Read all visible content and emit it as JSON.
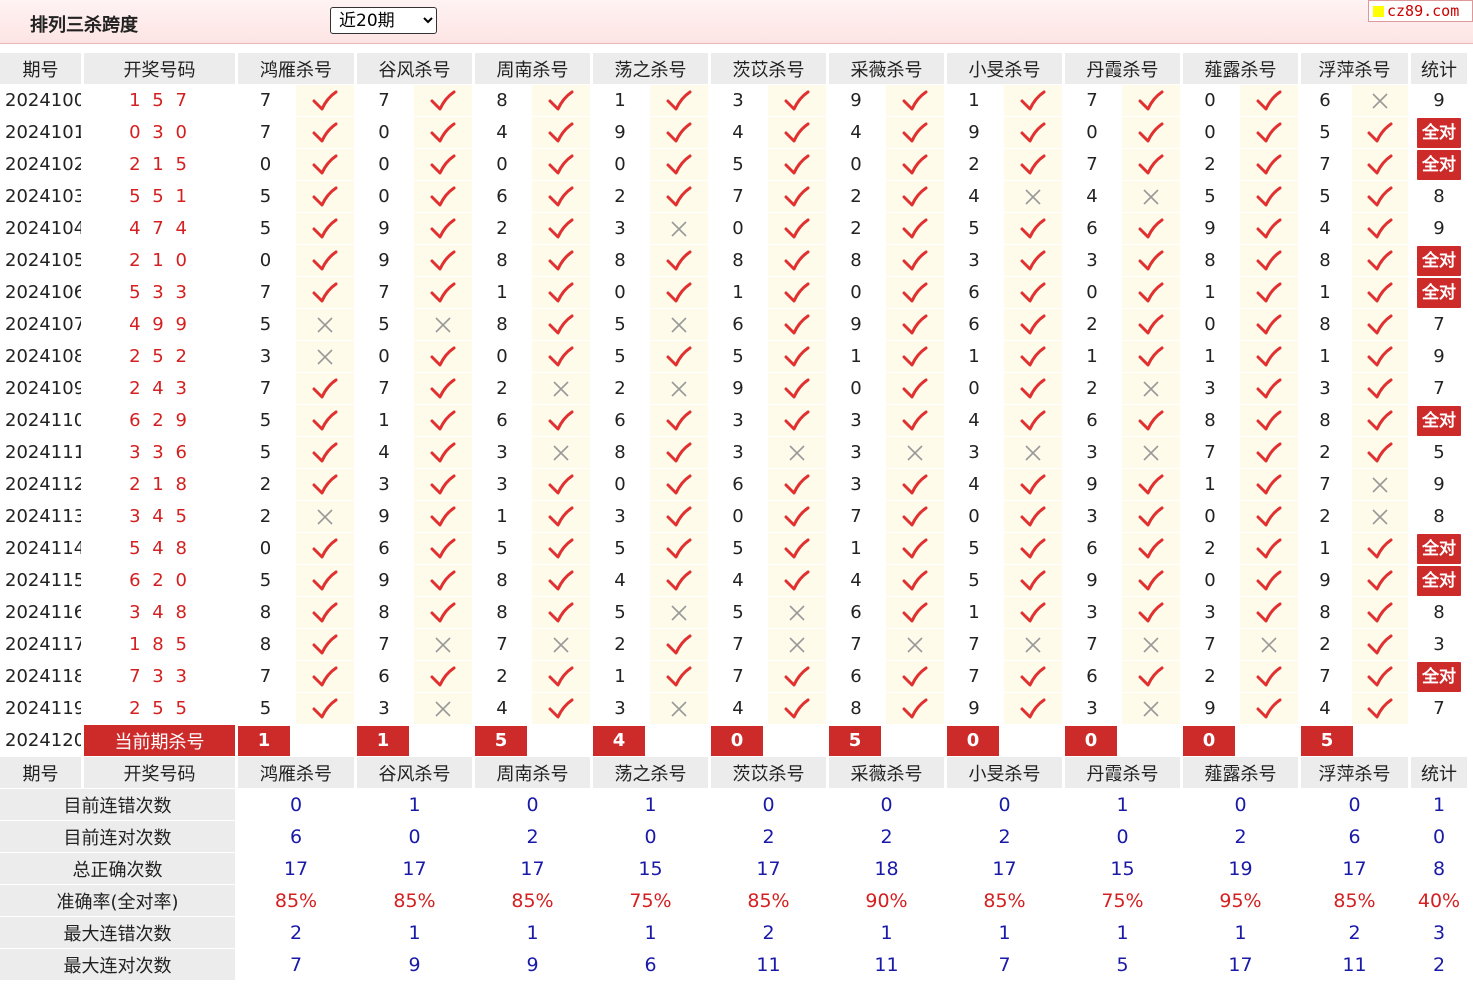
{
  "header": {
    "title": "排列三杀跨度",
    "period_select": {
      "selected": "近20期",
      "options": [
        "近20期"
      ]
    },
    "logo": "cz89.com"
  },
  "columns": [
    "期号",
    "开奖号码",
    "鸿雁杀号",
    "谷风杀号",
    "周南杀号",
    "荡之杀号",
    "茨苡杀号",
    "采薇杀号",
    "小旻杀号",
    "丹霞杀号",
    "薤露杀号",
    "浮萍杀号",
    "统计"
  ],
  "rows": [
    {
      "period": "2024100",
      "draw": "157",
      "kills": [
        [
          7,
          1
        ],
        [
          7,
          1
        ],
        [
          8,
          1
        ],
        [
          1,
          1
        ],
        [
          3,
          1
        ],
        [
          9,
          1
        ],
        [
          1,
          1
        ],
        [
          7,
          1
        ],
        [
          0,
          1
        ],
        [
          6,
          0
        ]
      ],
      "stat": "9"
    },
    {
      "period": "2024101",
      "draw": "030",
      "kills": [
        [
          7,
          1
        ],
        [
          0,
          1
        ],
        [
          4,
          1
        ],
        [
          9,
          1
        ],
        [
          4,
          1
        ],
        [
          4,
          1
        ],
        [
          9,
          1
        ],
        [
          0,
          1
        ],
        [
          0,
          1
        ],
        [
          5,
          1
        ]
      ],
      "stat": "全对"
    },
    {
      "period": "2024102",
      "draw": "215",
      "kills": [
        [
          0,
          1
        ],
        [
          0,
          1
        ],
        [
          0,
          1
        ],
        [
          0,
          1
        ],
        [
          5,
          1
        ],
        [
          0,
          1
        ],
        [
          2,
          1
        ],
        [
          7,
          1
        ],
        [
          2,
          1
        ],
        [
          7,
          1
        ]
      ],
      "stat": "全对"
    },
    {
      "period": "2024103",
      "draw": "551",
      "kills": [
        [
          5,
          1
        ],
        [
          0,
          1
        ],
        [
          6,
          1
        ],
        [
          2,
          1
        ],
        [
          7,
          1
        ],
        [
          2,
          1
        ],
        [
          4,
          0
        ],
        [
          4,
          0
        ],
        [
          5,
          1
        ],
        [
          5,
          1
        ]
      ],
      "stat": "8"
    },
    {
      "period": "2024104",
      "draw": "474",
      "kills": [
        [
          5,
          1
        ],
        [
          9,
          1
        ],
        [
          2,
          1
        ],
        [
          3,
          0
        ],
        [
          0,
          1
        ],
        [
          2,
          1
        ],
        [
          5,
          1
        ],
        [
          6,
          1
        ],
        [
          9,
          1
        ],
        [
          4,
          1
        ]
      ],
      "stat": "9"
    },
    {
      "period": "2024105",
      "draw": "210",
      "kills": [
        [
          0,
          1
        ],
        [
          9,
          1
        ],
        [
          8,
          1
        ],
        [
          8,
          1
        ],
        [
          8,
          1
        ],
        [
          8,
          1
        ],
        [
          3,
          1
        ],
        [
          3,
          1
        ],
        [
          8,
          1
        ],
        [
          8,
          1
        ]
      ],
      "stat": "全对"
    },
    {
      "period": "2024106",
      "draw": "533",
      "kills": [
        [
          7,
          1
        ],
        [
          7,
          1
        ],
        [
          1,
          1
        ],
        [
          0,
          1
        ],
        [
          1,
          1
        ],
        [
          0,
          1
        ],
        [
          6,
          1
        ],
        [
          0,
          1
        ],
        [
          1,
          1
        ],
        [
          1,
          1
        ]
      ],
      "stat": "全对"
    },
    {
      "period": "2024107",
      "draw": "499",
      "kills": [
        [
          5,
          0
        ],
        [
          5,
          0
        ],
        [
          8,
          1
        ],
        [
          5,
          0
        ],
        [
          6,
          1
        ],
        [
          9,
          1
        ],
        [
          6,
          1
        ],
        [
          2,
          1
        ],
        [
          0,
          1
        ],
        [
          8,
          1
        ]
      ],
      "stat": "7"
    },
    {
      "period": "2024108",
      "draw": "252",
      "kills": [
        [
          3,
          0
        ],
        [
          0,
          1
        ],
        [
          0,
          1
        ],
        [
          5,
          1
        ],
        [
          5,
          1
        ],
        [
          1,
          1
        ],
        [
          1,
          1
        ],
        [
          1,
          1
        ],
        [
          1,
          1
        ],
        [
          1,
          1
        ]
      ],
      "stat": "9"
    },
    {
      "period": "2024109",
      "draw": "243",
      "kills": [
        [
          7,
          1
        ],
        [
          7,
          1
        ],
        [
          2,
          0
        ],
        [
          2,
          0
        ],
        [
          9,
          1
        ],
        [
          0,
          1
        ],
        [
          0,
          1
        ],
        [
          2,
          0
        ],
        [
          3,
          1
        ],
        [
          3,
          1
        ]
      ],
      "stat": "7"
    },
    {
      "period": "2024110",
      "draw": "629",
      "kills": [
        [
          5,
          1
        ],
        [
          1,
          1
        ],
        [
          6,
          1
        ],
        [
          6,
          1
        ],
        [
          3,
          1
        ],
        [
          3,
          1
        ],
        [
          4,
          1
        ],
        [
          6,
          1
        ],
        [
          8,
          1
        ],
        [
          8,
          1
        ]
      ],
      "stat": "全对"
    },
    {
      "period": "2024111",
      "draw": "336",
      "kills": [
        [
          5,
          1
        ],
        [
          4,
          1
        ],
        [
          3,
          0
        ],
        [
          8,
          1
        ],
        [
          3,
          0
        ],
        [
          3,
          0
        ],
        [
          3,
          0
        ],
        [
          3,
          0
        ],
        [
          7,
          1
        ],
        [
          2,
          1
        ]
      ],
      "stat": "5"
    },
    {
      "period": "2024112",
      "draw": "218",
      "kills": [
        [
          2,
          1
        ],
        [
          3,
          1
        ],
        [
          3,
          1
        ],
        [
          0,
          1
        ],
        [
          6,
          1
        ],
        [
          3,
          1
        ],
        [
          4,
          1
        ],
        [
          9,
          1
        ],
        [
          1,
          1
        ],
        [
          7,
          0
        ]
      ],
      "stat": "9"
    },
    {
      "period": "2024113",
      "draw": "345",
      "kills": [
        [
          2,
          0
        ],
        [
          9,
          1
        ],
        [
          1,
          1
        ],
        [
          3,
          1
        ],
        [
          0,
          1
        ],
        [
          7,
          1
        ],
        [
          0,
          1
        ],
        [
          3,
          1
        ],
        [
          0,
          1
        ],
        [
          2,
          0
        ]
      ],
      "stat": "8"
    },
    {
      "period": "2024114",
      "draw": "548",
      "kills": [
        [
          0,
          1
        ],
        [
          6,
          1
        ],
        [
          5,
          1
        ],
        [
          5,
          1
        ],
        [
          5,
          1
        ],
        [
          1,
          1
        ],
        [
          5,
          1
        ],
        [
          6,
          1
        ],
        [
          2,
          1
        ],
        [
          1,
          1
        ]
      ],
      "stat": "全对"
    },
    {
      "period": "2024115",
      "draw": "620",
      "kills": [
        [
          5,
          1
        ],
        [
          9,
          1
        ],
        [
          8,
          1
        ],
        [
          4,
          1
        ],
        [
          4,
          1
        ],
        [
          4,
          1
        ],
        [
          5,
          1
        ],
        [
          9,
          1
        ],
        [
          0,
          1
        ],
        [
          9,
          1
        ]
      ],
      "stat": "全对"
    },
    {
      "period": "2024116",
      "draw": "348",
      "kills": [
        [
          8,
          1
        ],
        [
          8,
          1
        ],
        [
          8,
          1
        ],
        [
          5,
          0
        ],
        [
          5,
          0
        ],
        [
          6,
          1
        ],
        [
          1,
          1
        ],
        [
          3,
          1
        ],
        [
          3,
          1
        ],
        [
          8,
          1
        ]
      ],
      "stat": "8"
    },
    {
      "period": "2024117",
      "draw": "185",
      "kills": [
        [
          8,
          1
        ],
        [
          7,
          0
        ],
        [
          7,
          0
        ],
        [
          2,
          1
        ],
        [
          7,
          0
        ],
        [
          7,
          0
        ],
        [
          7,
          0
        ],
        [
          7,
          0
        ],
        [
          7,
          0
        ],
        [
          2,
          1
        ]
      ],
      "stat": "3"
    },
    {
      "period": "2024118",
      "draw": "733",
      "kills": [
        [
          7,
          1
        ],
        [
          6,
          1
        ],
        [
          2,
          1
        ],
        [
          1,
          1
        ],
        [
          7,
          1
        ],
        [
          6,
          1
        ],
        [
          7,
          1
        ],
        [
          6,
          1
        ],
        [
          2,
          1
        ],
        [
          7,
          1
        ]
      ],
      "stat": "全对"
    },
    {
      "period": "2024119",
      "draw": "255",
      "kills": [
        [
          5,
          1
        ],
        [
          3,
          0
        ],
        [
          4,
          1
        ],
        [
          3,
          0
        ],
        [
          4,
          1
        ],
        [
          8,
          1
        ],
        [
          9,
          1
        ],
        [
          3,
          0
        ],
        [
          9,
          1
        ],
        [
          4,
          1
        ]
      ],
      "stat": "7"
    }
  ],
  "current": {
    "period": "2024120",
    "label": "当前期杀号",
    "values": [
      "1",
      "1",
      "5",
      "4",
      "0",
      "5",
      "0",
      "0",
      "0",
      "5"
    ]
  },
  "summary": [
    {
      "label": "目前连错次数",
      "values": [
        "0",
        "1",
        "0",
        "1",
        "0",
        "0",
        "0",
        "1",
        "0",
        "0",
        "1"
      ],
      "red": false
    },
    {
      "label": "目前连对次数",
      "values": [
        "6",
        "0",
        "2",
        "0",
        "2",
        "2",
        "2",
        "0",
        "2",
        "6",
        "0"
      ],
      "red": false
    },
    {
      "label": "总正确次数",
      "values": [
        "17",
        "17",
        "17",
        "15",
        "17",
        "18",
        "17",
        "15",
        "19",
        "17",
        "8"
      ],
      "red": false
    },
    {
      "label": "准确率(全对率)",
      "values": [
        "85%",
        "85%",
        "85%",
        "75%",
        "85%",
        "90%",
        "85%",
        "75%",
        "95%",
        "85%",
        "40%"
      ],
      "red": true
    },
    {
      "label": "最大连错次数",
      "values": [
        "2",
        "1",
        "1",
        "1",
        "2",
        "1",
        "1",
        "1",
        "1",
        "2",
        "3"
      ],
      "red": false
    },
    {
      "label": "最大连对次数",
      "values": [
        "7",
        "9",
        "9",
        "6",
        "11",
        "11",
        "7",
        "5",
        "17",
        "11",
        "2"
      ],
      "red": false
    }
  ],
  "colors": {
    "accent": "#cd2a2a",
    "draw_text": "#d42020",
    "summary_blue": "#1a1aa8",
    "header_bg": "#ececec",
    "mark_bg": "#fefbea"
  },
  "icons": {
    "correct": "check-icon",
    "wrong": "cross-icon"
  }
}
